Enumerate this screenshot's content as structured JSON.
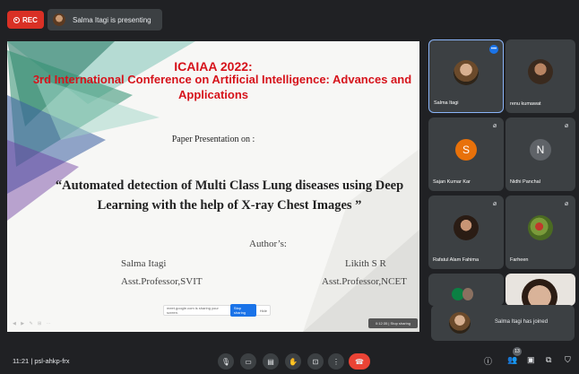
{
  "top_bar": {
    "rec_label": "REC",
    "presenting_text": "Salma Itagi is presenting"
  },
  "slide": {
    "title_line1": "ICAIAA 2022:",
    "title_line2": "3rd International Conference on Artificial Intelligence: Advances and",
    "title_line3": "Applications",
    "paper_presentation": "Paper Presentation on :",
    "paper_title_line1": "“Automated detection of Multi Class Lung diseases using Deep",
    "paper_title_line2": "Learning with the help of X-ray Chest Images ”",
    "authors_heading": "Author’s:",
    "author1_name": "Salma Itagi",
    "author1_affil": "Asst.Professor,SVIT",
    "author2_name": "Likith S R",
    "author2_affil": "Asst.Professor,NCET",
    "share_notice": "meet.google.com is sharing your screen.",
    "share_stop": "Stop sharing",
    "share_hide": "Hide",
    "stop_pill_text": "0:12:35 | Stop sharing",
    "accent_color": "#d6131b"
  },
  "participants": [
    {
      "name": "Salma Itagi",
      "speaking": true
    },
    {
      "name": "renu kumawat",
      "muted": false
    },
    {
      "name": "Sajan Kumar Kar",
      "letter": "S",
      "color": "#e8710a",
      "muted": true
    },
    {
      "name": "Nidhi Panchal",
      "letter": "N",
      "color": "#5f6368",
      "muted": true
    },
    {
      "name": "Rafatul Alam Fahima",
      "muted": true
    },
    {
      "name": "Farheen",
      "muted": true
    }
  ],
  "toast": {
    "text": "Salma Itagi has joined"
  },
  "bottom_bar": {
    "time": "11:21",
    "separator": "|",
    "meeting_code": "psl-ahkp-frx",
    "people_count": "13"
  }
}
